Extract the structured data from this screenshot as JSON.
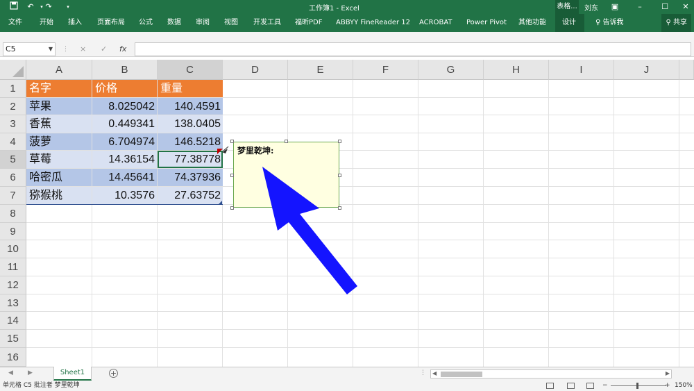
{
  "titlebar": {
    "title": "工作簿1 - Excel",
    "context_tab": "表格...",
    "user": "刘东",
    "save_icon": "save-icon",
    "undo_icon": "undo-icon",
    "redo_icon": "redo-icon"
  },
  "ribbon": {
    "tabs": [
      "文件",
      "开始",
      "插入",
      "页面布局",
      "公式",
      "数据",
      "审阅",
      "视图",
      "开发工具",
      "福昕PDF",
      "ABBYY FineReader 12",
      "ACROBAT",
      "Power Pivot",
      "其他功能",
      "设计"
    ],
    "tell_me": "告诉我",
    "share": "共享"
  },
  "formula_bar": {
    "name_box": "C5",
    "cancel_icon": "×",
    "enter_icon": "✓",
    "fx_label": "fx",
    "formula": ""
  },
  "columns": [
    "A",
    "B",
    "C",
    "D",
    "E",
    "F",
    "G",
    "H",
    "I",
    "J"
  ],
  "rows": [
    "1",
    "2",
    "3",
    "4",
    "5",
    "6",
    "7",
    "8",
    "9",
    "10",
    "11",
    "12",
    "13",
    "14",
    "15",
    "16"
  ],
  "table": {
    "headers": [
      "名字",
      "价格",
      "重量"
    ],
    "rows": [
      [
        "苹果",
        "8.025042",
        "140.4591"
      ],
      [
        "香蕉",
        "0.449341",
        "138.0405"
      ],
      [
        "菠萝",
        "6.704974",
        "146.5218"
      ],
      [
        "草莓",
        "14.36154",
        "77.38778"
      ],
      [
        "哈密瓜",
        "14.45641",
        "74.37936"
      ],
      [
        "猕猴桃",
        "10.3576",
        "27.63752"
      ]
    ]
  },
  "comment": {
    "text": "梦里乾坤:"
  },
  "sheet_tabs": [
    "Sheet1"
  ],
  "status_bar": {
    "message": "单元格 C5 批注者 梦里乾坤",
    "zoom": "150%"
  },
  "colors": {
    "excel_green": "#217346",
    "header_orange": "#ed7d31",
    "band_dark": "#b4c6e7",
    "band_light": "#d9e1f2",
    "arrow_blue": "#1a1aff",
    "comment_bg": "#ffffe1"
  }
}
